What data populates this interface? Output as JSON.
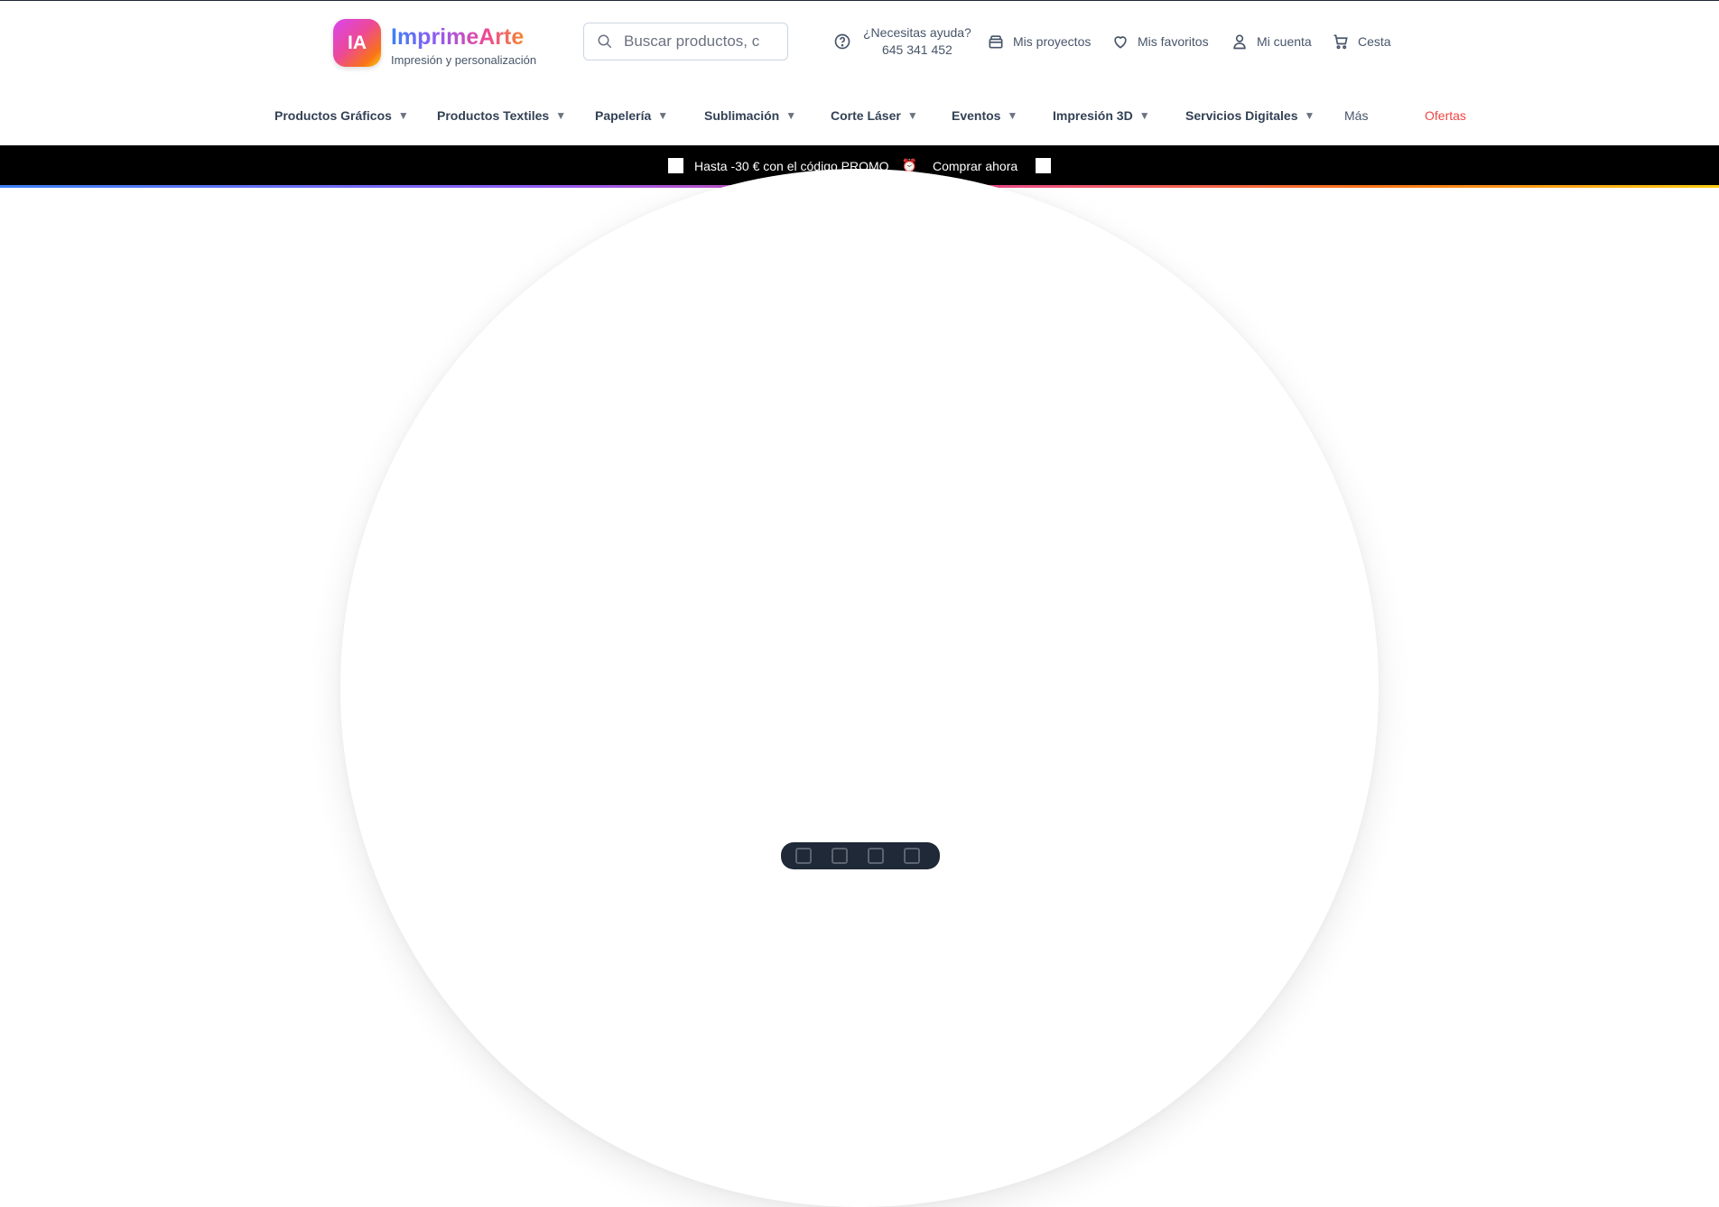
{
  "header": {
    "logo_badge": "IA",
    "brand": "ImprimeArte",
    "tagline": "Impresión y personalización",
    "search_placeholder": "Buscar productos, categorías...",
    "help": {
      "question": "¿Necesitas ayuda?",
      "phone": "645 341 452"
    },
    "links": {
      "projects": "Mis proyectos",
      "favorites": "Mis favoritos",
      "account": "Mi cuenta",
      "cart": "Cesta"
    }
  },
  "nav": {
    "items": [
      {
        "label": "Productos Gráficos",
        "caret": "▼"
      },
      {
        "label": "Productos Textiles",
        "caret": "▼"
      },
      {
        "label": "Papelería",
        "caret": "▼"
      },
      {
        "label": "Sublimación",
        "caret": "▼"
      },
      {
        "label": "Corte Láser",
        "caret": "▼"
      },
      {
        "label": "Eventos",
        "caret": "▼"
      },
      {
        "label": "Impresión 3D",
        "caret": "▼"
      },
      {
        "label": "Servicios Digitales",
        "caret": "▼"
      }
    ],
    "more": "Más",
    "offers": "Ofertas"
  },
  "promo": {
    "text": "Hasta -30 € con el código PROMO",
    "emoji": "⏰",
    "link": "Comprar ahora"
  },
  "colors": {
    "promo_bg": "#000000",
    "offers": "#ef4444",
    "text": "#334155"
  },
  "icons": {
    "search": "search-icon",
    "help": "help-circle-icon",
    "projects": "box-icon",
    "favorites": "heart-icon",
    "account": "user-icon",
    "cart": "cart-icon"
  }
}
